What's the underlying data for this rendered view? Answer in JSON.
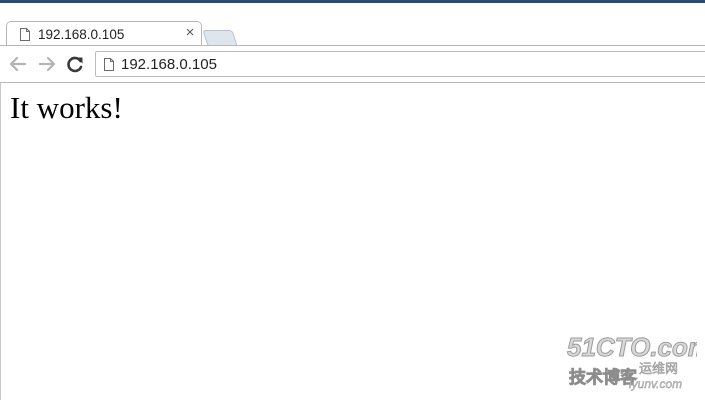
{
  "browser": {
    "tab": {
      "title": "192.168.0.105",
      "close_glyph": "×",
      "page_icon": "page-icon"
    },
    "toolbar": {
      "back_icon": "arrow-left-icon",
      "forward_icon": "arrow-right-icon",
      "reload_icon": "reload-icon"
    },
    "omnibox": {
      "url": "192.168.0.105",
      "page_icon": "page-icon"
    }
  },
  "page": {
    "heading": "It works!"
  },
  "watermark": {
    "line1": "51CTO.com",
    "line2": "技术博客",
    "line3": "运维网",
    "line4": "iyunv.com"
  },
  "colors": {
    "top_strip": "#2d4a73",
    "new_tab_fill": "#dfe5ec",
    "border": "#b8b8b8"
  }
}
